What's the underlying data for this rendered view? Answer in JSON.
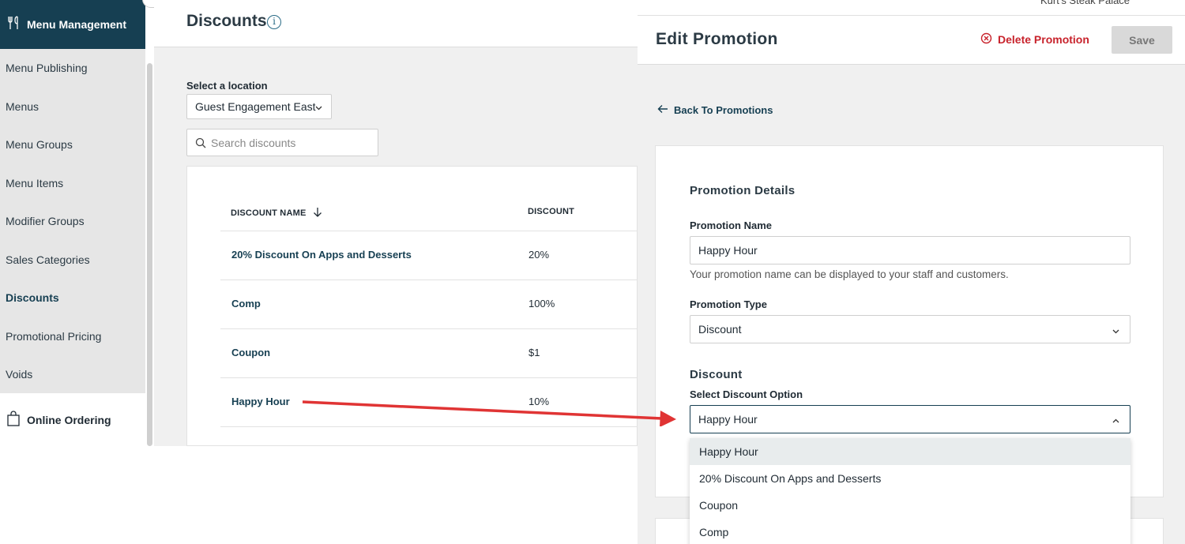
{
  "sidebar": {
    "header": "Menu Management",
    "items": [
      {
        "label": "Menu Publishing"
      },
      {
        "label": "Menus"
      },
      {
        "label": "Menu Groups"
      },
      {
        "label": "Menu Items"
      },
      {
        "label": "Modifier Groups"
      },
      {
        "label": "Sales Categories"
      },
      {
        "label": "Discounts",
        "active": true
      },
      {
        "label": "Promotional Pricing"
      },
      {
        "label": "Voids"
      }
    ],
    "online": "Online Ordering"
  },
  "main": {
    "title": "Discounts",
    "location_label": "Select a location",
    "location_value": "Guest Engagement East",
    "search_placeholder": "Search discounts",
    "columns": [
      "DISCOUNT NAME",
      "DISCOUNT"
    ],
    "rows": [
      {
        "name": "20% Discount On Apps and Desserts",
        "value": "20%"
      },
      {
        "name": "Comp",
        "value": "100%"
      },
      {
        "name": "Coupon",
        "value": "$1"
      },
      {
        "name": "Happy Hour",
        "value": "10%"
      }
    ]
  },
  "panel": {
    "account": "Kurt's Steak Palace",
    "title": "Edit Promotion",
    "delete_label": "Delete Promotion",
    "save_label": "Save",
    "back_label": "Back To Promotions",
    "section_title": "Promotion Details",
    "name_label": "Promotion Name",
    "name_value": "Happy Hour",
    "name_hint": "Your promotion name can be displayed to your staff and customers.",
    "type_label": "Promotion Type",
    "type_value": "Discount",
    "discount_title": "Discount",
    "discount_option_label": "Select Discount Option",
    "discount_option_value": "Happy Hour",
    "options": [
      {
        "label": "Happy Hour",
        "selected": true
      },
      {
        "label": "20% Discount On Apps and Desserts"
      },
      {
        "label": "Coupon"
      },
      {
        "label": "Comp"
      }
    ]
  },
  "colors": {
    "brand": "#163f52",
    "danger": "#c8232c",
    "annotation_arrow": "#e03434"
  }
}
